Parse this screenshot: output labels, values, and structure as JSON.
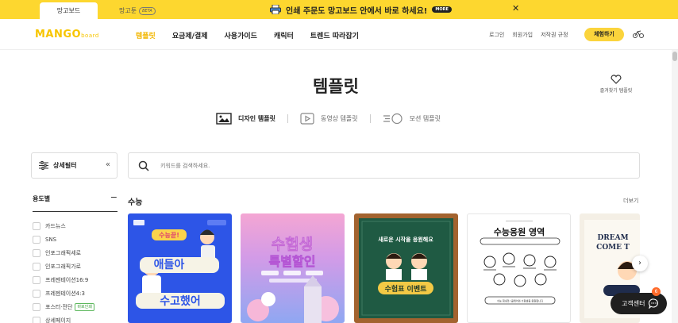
{
  "promo_bar": {
    "tab_active": "망고보드",
    "tab_other": "망고툰",
    "beta": "BETA",
    "message": "인쇄 주문도 망고보드 안에서 바로 하세요!",
    "more": "MORE",
    "close": "✕",
    "color": "#fdd72f"
  },
  "header": {
    "logo_main": "MANGO",
    "logo_sub": "board",
    "nav": [
      "템플릿",
      "요금제/결제",
      "사용가이드",
      "캐릭터",
      "트렌드 따라잡기"
    ],
    "links": [
      "로그인",
      "회원가입",
      "저작권 규정"
    ],
    "trial": "체험하기",
    "accent": "#f2b600"
  },
  "main": {
    "title": "템플릿",
    "favorites": "즐겨찾기 템플릿",
    "tabs": [
      "디자인 템플릿",
      "동영상 템플릿",
      "모션 템플릿"
    ]
  },
  "filter": {
    "label": "상세필터",
    "collapse": "«"
  },
  "search": {
    "placeholder": "키워드를 검색하세요."
  },
  "sidebar": {
    "section": "용도별",
    "toggle": "−",
    "items": [
      {
        "label": "카드뉴스",
        "badge": ""
      },
      {
        "label": "SNS",
        "badge": ""
      },
      {
        "label": "인포그래픽세로",
        "badge": ""
      },
      {
        "label": "인포그래픽가로",
        "badge": ""
      },
      {
        "label": "프레젠테이션16:9",
        "badge": ""
      },
      {
        "label": "프레젠테이션4:3",
        "badge": ""
      },
      {
        "label": "포스터·전단",
        "badge": "바로인쇄"
      },
      {
        "label": "상세페이지",
        "badge": ""
      }
    ]
  },
  "section": {
    "title": "수능",
    "more": "더보기",
    "cards": [
      {
        "line1": "수능끝!",
        "line2": "애들아",
        "line3": "수고했어"
      },
      {
        "line1": "수험생",
        "line2": "특별할인"
      },
      {
        "line1": "새로운 시작을 응원해요",
        "line2": "수험표 이벤트"
      },
      {
        "line1": "수능응원 영역",
        "line2": "수능 힘내라! 클레어와 수험생을 응원합니다"
      },
      {
        "line1": "DREAM",
        "line2": "COME T"
      }
    ]
  },
  "help": {
    "label": "고객센터",
    "count": "6"
  }
}
